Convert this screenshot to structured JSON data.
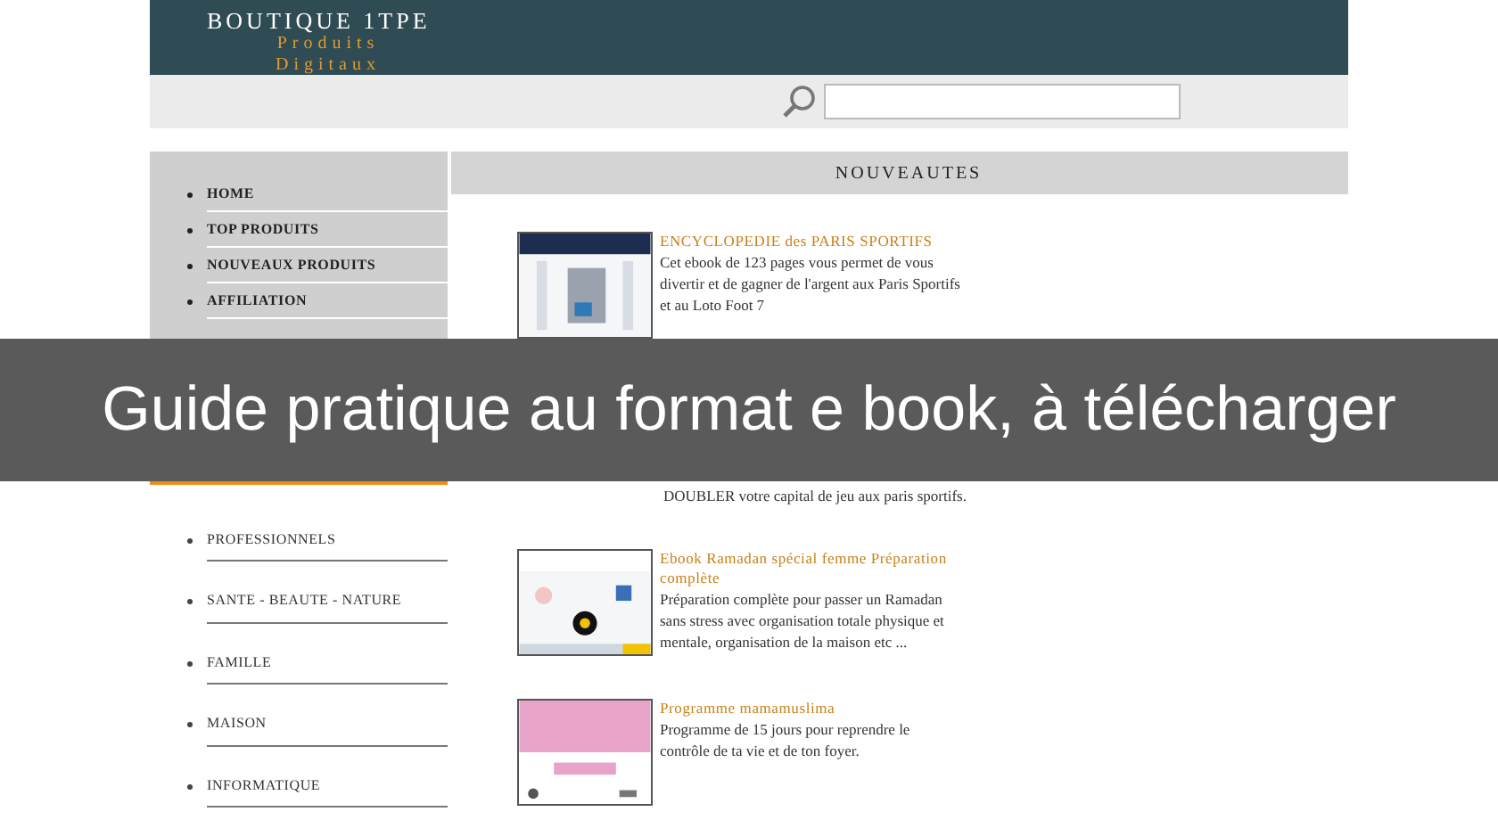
{
  "header": {
    "title": "BOUTIQUE 1TPE",
    "subtitle": "Produits Digitaux"
  },
  "menu": [
    {
      "label": "HOME"
    },
    {
      "label": "TOP PRODUITS"
    },
    {
      "label": "NOUVEAUX PRODUITS"
    },
    {
      "label": "AFFILIATION"
    }
  ],
  "categories": {
    "items": [
      {
        "label": "PROFESSIONNELS"
      },
      {
        "label": "SANTE - BEAUTE - NATURE"
      },
      {
        "label": "FAMILLE"
      },
      {
        "label": "MAISON"
      },
      {
        "label": "INFORMATIQUE"
      }
    ]
  },
  "section_title": "NOUVEAUTES",
  "products": [
    {
      "title": "ENCYCLOPEDIE des PARIS SPORTIFS",
      "description": "Cet ebook de 123 pages vous permet de vous divertir et de gagner de l'argent aux Paris Sportifs et au Loto Foot 7"
    },
    {
      "description": "DOUBLER votre capital de jeu aux paris sportifs."
    },
    {
      "title": "Ebook Ramadan spécial femme Préparation complète",
      "description": "Préparation complète pour passer un Ramadan sans stress avec organisation totale physique et mentale, organisation de la maison etc ..."
    },
    {
      "title": "Programme mamamuslima",
      "description": "Programme de 15 jours pour reprendre le contrôle de ta vie et de ton foyer."
    }
  ],
  "banner": {
    "text": "Guide pratique au format e book, à télécharger"
  }
}
